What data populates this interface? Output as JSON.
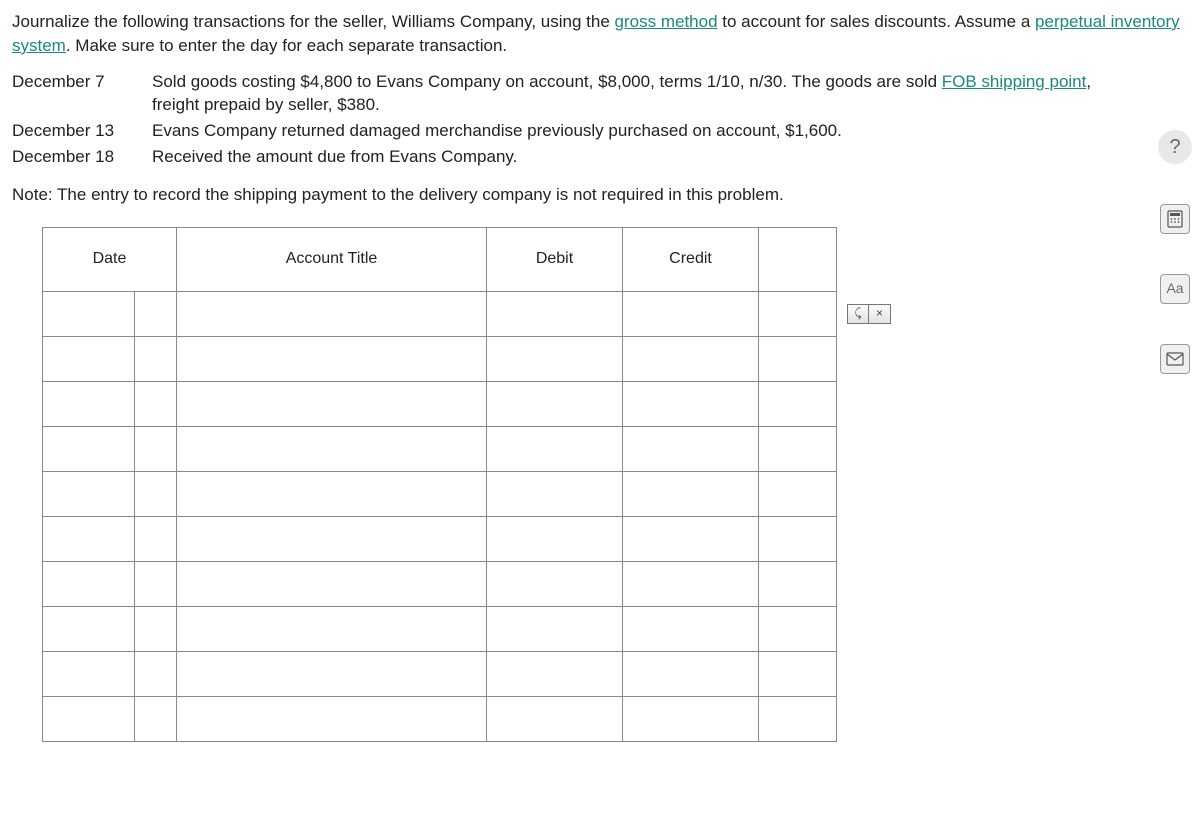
{
  "instructions": {
    "part1": "Journalize the following transactions for the seller, Williams Company, using the ",
    "link1": "gross method",
    "part2": " to account for sales discounts. Assume a ",
    "link2": "perpetual inventory system",
    "part3": ". Make sure to enter the day for each separate transaction."
  },
  "transactions": [
    {
      "date": "December 7",
      "desc_pre": "Sold goods costing $4,800 to Evans Company on account, $8,000, terms 1/10, n/30. The goods are sold ",
      "desc_link": "FOB shipping point",
      "desc_post": ", freight prepaid by seller, $380."
    },
    {
      "date": "December 13",
      "desc_pre": "Evans Company returned damaged merchandise previously purchased on account, $1,600.",
      "desc_link": "",
      "desc_post": ""
    },
    {
      "date": "December 18",
      "desc_pre": "Received the amount due from Evans Company.",
      "desc_link": "",
      "desc_post": ""
    }
  ],
  "note": "Note: The entry to record the shipping payment to the delivery company is not required in this problem.",
  "journal": {
    "headers": {
      "date": "Date",
      "title": "Account Title",
      "debit": "Debit",
      "credit": "Credit"
    },
    "row_count": 10
  },
  "sidebar": {
    "help": "?",
    "calc": "⊞",
    "font": "Aa",
    "mail": "✉"
  },
  "row_actions": {
    "add": "⤹",
    "remove": "×"
  }
}
